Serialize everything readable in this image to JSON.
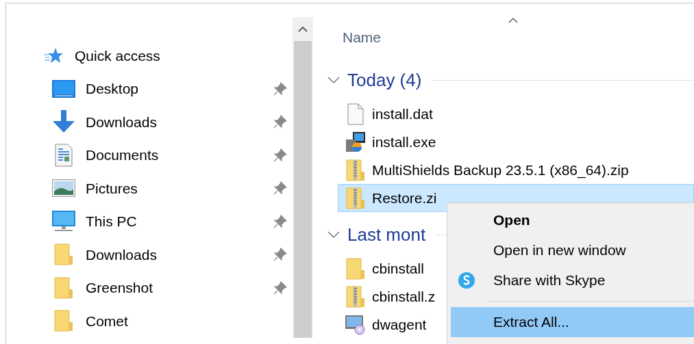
{
  "nav_pane": {
    "header": {
      "label": "Quick access"
    },
    "items": [
      {
        "label": "Desktop",
        "kind": "desktop",
        "pinned": true,
        "selected": false
      },
      {
        "label": "Downloads",
        "kind": "download",
        "pinned": true,
        "selected": false
      },
      {
        "label": "Documents",
        "kind": "document",
        "pinned": true,
        "selected": false
      },
      {
        "label": "Pictures",
        "kind": "pictures",
        "pinned": true,
        "selected": false
      },
      {
        "label": "This PC",
        "kind": "pc",
        "pinned": true,
        "selected": false
      },
      {
        "label": "Downloads",
        "kind": "folder",
        "pinned": true,
        "selected": false
      },
      {
        "label": "Greenshot",
        "kind": "folder",
        "pinned": true,
        "selected": false
      },
      {
        "label": "Comet",
        "kind": "folder",
        "pinned": false,
        "selected": false
      }
    ]
  },
  "file_list": {
    "columns": [
      {
        "label": "Name",
        "sort_ascending": true
      }
    ],
    "groups": [
      {
        "label": "Today (4)",
        "expanded": true,
        "items": [
          {
            "name": "install.dat",
            "kind": "file",
            "selected": false
          },
          {
            "name": "install.exe",
            "kind": "installer",
            "selected": false
          },
          {
            "name": "MultiShields Backup 23.5.1 (x86_64).zip",
            "kind": "zip",
            "selected": false
          },
          {
            "name": "Restore.zi",
            "kind": "zip",
            "selected": true
          }
        ]
      },
      {
        "label": "Last mont",
        "expanded": true,
        "items": [
          {
            "name": "cbinstall",
            "kind": "folder",
            "selected": false
          },
          {
            "name": "cbinstall.z",
            "kind": "zip",
            "selected": false
          },
          {
            "name": "dwagent",
            "kind": "setup",
            "selected": false
          }
        ]
      }
    ]
  },
  "context_menu": {
    "items": [
      {
        "kind": "default",
        "label": "Open",
        "selected": false
      },
      {
        "kind": "item",
        "label": "Open in new window",
        "selected": false
      },
      {
        "kind": "skype",
        "label": "Share with Skype",
        "selected": false
      },
      {
        "kind": "separator"
      },
      {
        "kind": "item",
        "label": "Extract All...",
        "selected": true
      }
    ]
  }
}
